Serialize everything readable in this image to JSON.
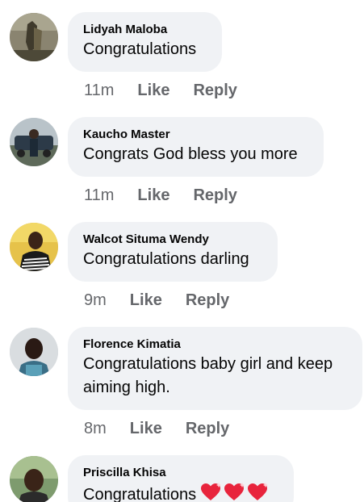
{
  "comments": [
    {
      "author": "Lidyah Maloba",
      "text": "Congratulations",
      "time": "11m",
      "like_label": "Like",
      "reply_label": "Reply"
    },
    {
      "author": "Kaucho Master",
      "text": "Congrats God bless you more",
      "time": "11m",
      "like_label": "Like",
      "reply_label": "Reply"
    },
    {
      "author": "Walcot Situma Wendy",
      "text": "Congratulations darling",
      "time": "9m",
      "like_label": "Like",
      "reply_label": "Reply"
    },
    {
      "author": "Florence Kimatia",
      "text": "Congratulations baby girl and keep aiming high.",
      "time": "8m",
      "like_label": "Like",
      "reply_label": "Reply"
    },
    {
      "author": "Priscilla Khisa",
      "text": "Congratulations",
      "emoji": "sparkling-heart x3"
    }
  ],
  "colors": {
    "bubble_bg": "#f0f2f5",
    "meta_text": "#65676b",
    "text": "#050505",
    "heart": "#e8243c"
  }
}
